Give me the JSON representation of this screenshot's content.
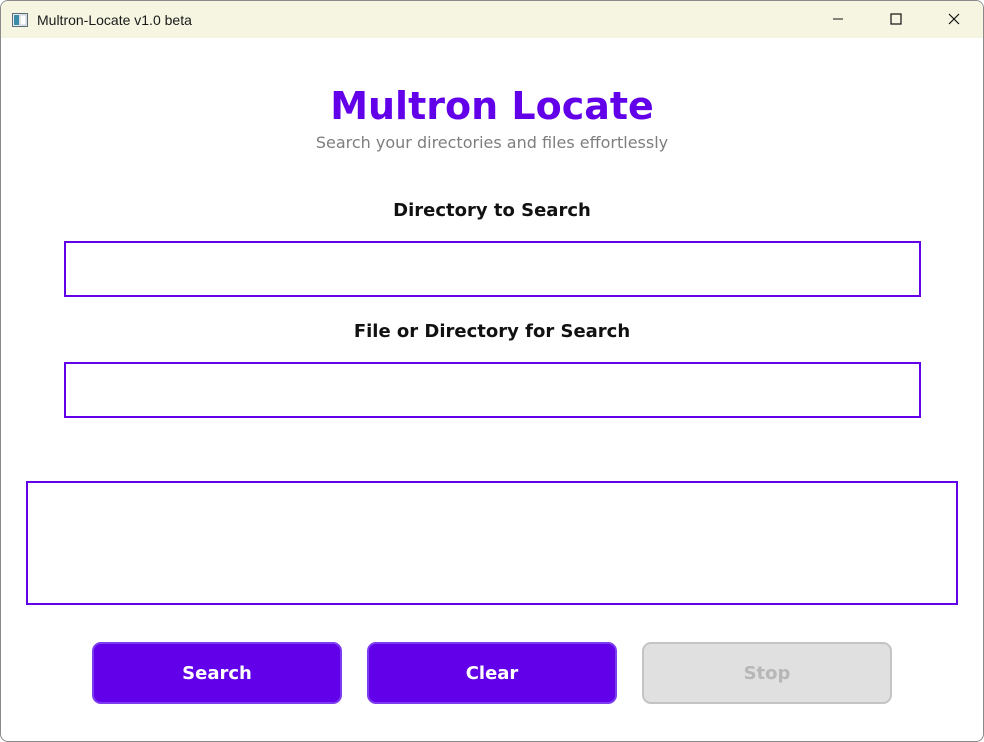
{
  "window": {
    "title": "Multron-Locate v1.0 beta",
    "controls": [
      "minimize-icon",
      "maximize-icon",
      "close-icon"
    ]
  },
  "header": {
    "title": "Multron Locate",
    "subtitle": "Search your directories and files effortlessly"
  },
  "form": {
    "directory_label": "Directory to Search",
    "directory_value": "",
    "target_label": "File or Directory for Search",
    "target_value": ""
  },
  "results": {
    "value": ""
  },
  "actions": {
    "search_label": "Search",
    "clear_label": "Clear",
    "stop_label": "Stop",
    "stop_enabled": false
  },
  "colors": {
    "accent": "#6200ea",
    "titlebar": "#f5f5e1",
    "subtitle": "#7e7e7e",
    "disabled_bg": "#e0e0e0",
    "disabled_text": "#b7b7b7"
  }
}
